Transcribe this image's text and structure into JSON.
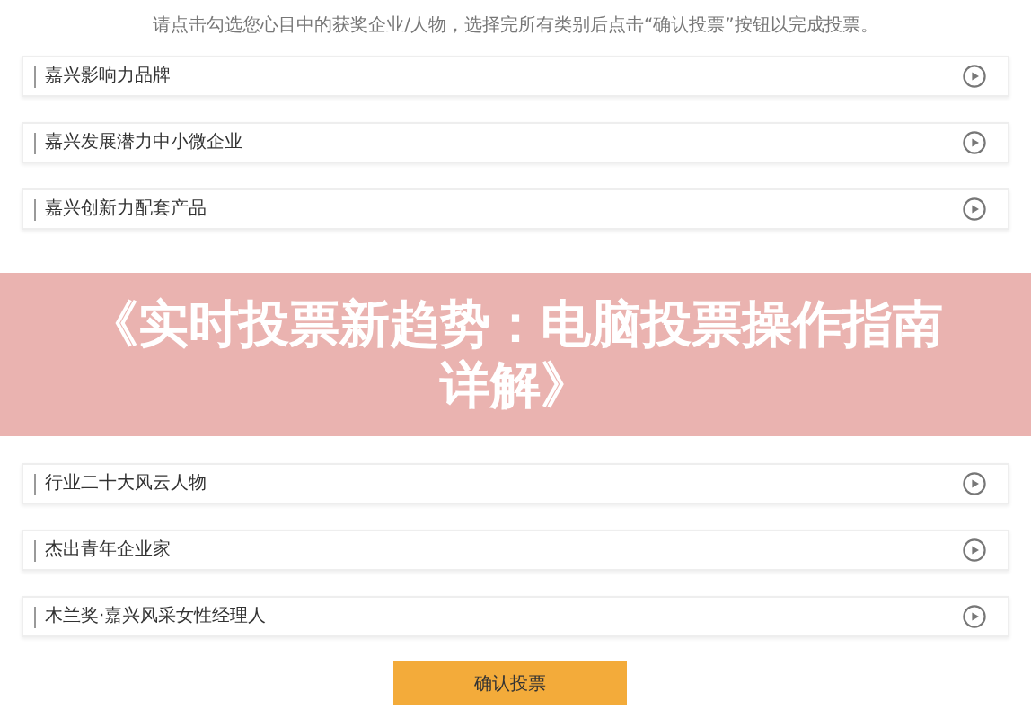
{
  "instruction": "请点击勾选您心目中的获奖企业/人物，选择完所有类别后点击“确认投票”按钮以完成投票。",
  "categories_above": [
    {
      "label": "嘉兴影响力品牌"
    },
    {
      "label": "嘉兴发展潜力中小微企业"
    },
    {
      "label": "嘉兴创新力配套产品"
    }
  ],
  "banner": {
    "title": "《实时投票新趋势：电脑投票操作指南详解》"
  },
  "categories_below": [
    {
      "label": "行业二十大风云人物"
    },
    {
      "label": "杰出青年企业家"
    },
    {
      "label": "木兰奖·嘉兴风采女性经理人"
    }
  ],
  "submit_button": "确认投票"
}
